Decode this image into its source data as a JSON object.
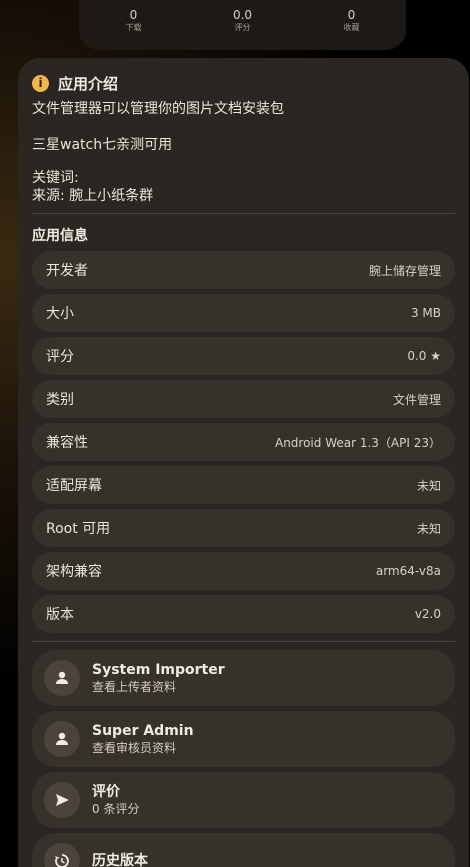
{
  "stats": [
    {
      "value": "0",
      "label": "下载"
    },
    {
      "value": "0.0",
      "label": "评分"
    },
    {
      "value": "0",
      "label": "收藏"
    }
  ],
  "intro": {
    "title": "应用介绍",
    "line1": "文件管理器可以管理你的图片文档安装包",
    "line2": "三星watch七亲测可用",
    "keywords": "关键词:",
    "source": "来源: 腕上小纸条群"
  },
  "app_info": {
    "title": "应用信息",
    "rows": [
      {
        "key": "开发者",
        "value": "腕上储存管理"
      },
      {
        "key": "大小",
        "value": "3 MB"
      },
      {
        "key": "评分",
        "value": "0.0 ★"
      },
      {
        "key": "类别",
        "value": "文件管理"
      },
      {
        "key": "兼容性",
        "value": "Android Wear 1.3（API 23）"
      },
      {
        "key": "适配屏幕",
        "value": "未知"
      },
      {
        "key": "Root 可用",
        "value": "未知"
      },
      {
        "key": "架构兼容",
        "value": "arm64-v8a"
      },
      {
        "key": "版本",
        "value": "v2.0"
      }
    ]
  },
  "people": [
    {
      "name": "System Importer",
      "sub": "查看上传者资料",
      "icon": "person-icon"
    },
    {
      "name": "Super Admin",
      "sub": "查看审核员资料",
      "icon": "person-icon"
    },
    {
      "name": "评价",
      "sub": "0 条评分",
      "icon": "send-icon"
    },
    {
      "name": "历史版本",
      "sub": "",
      "icon": "history-icon"
    }
  ]
}
